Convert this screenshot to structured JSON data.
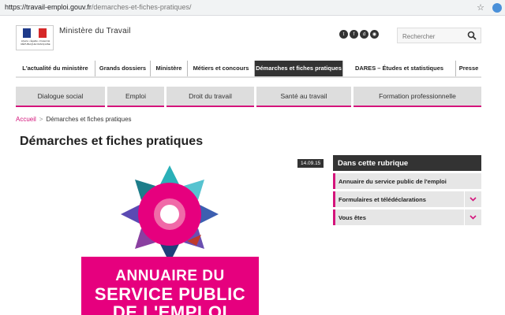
{
  "browser": {
    "url_host": "https://travail-emploi.gouv.fr",
    "url_path": "/demarches-et-fiches-pratiques/"
  },
  "header": {
    "logo_text": "Liberté • Égalité • Fraternité RÉPUBLIQUE FRANÇAISE",
    "site_title": "Ministère du Travail",
    "social": [
      "twitter-icon",
      "facebook-icon",
      "dailymotion-icon",
      "rss-icon"
    ],
    "search_placeholder": "Rechercher"
  },
  "nav": {
    "items": [
      {
        "label": "L'actualité du ministère"
      },
      {
        "label": "Grands dossiers"
      },
      {
        "label": "Ministère"
      },
      {
        "label": "Métiers et concours"
      },
      {
        "label": "Démarches et fiches pratiques"
      },
      {
        "label": "DARES – Études et statistiques"
      },
      {
        "label": "Presse"
      }
    ],
    "active_index": 4
  },
  "subnav": {
    "items": [
      "Dialogue social",
      "Emploi",
      "Droit du travail",
      "Santé au travail",
      "Formation professionnelle"
    ]
  },
  "breadcrumb": {
    "home": "Accueil",
    "separator": ">",
    "current": "Démarches et fiches pratiques"
  },
  "page": {
    "title": "Démarches et fiches pratiques",
    "date": "14.09.15"
  },
  "poster": {
    "line1": "ANNUAIRE DU",
    "line2": "SERVICE PUBLIC",
    "line3": "DE L'EMPLOI"
  },
  "sidebar": {
    "heading": "Dans cette rubrique",
    "items": [
      {
        "label": "Annuaire du service public de l'emploi"
      },
      {
        "label": "Formulaires et télédéclarations"
      },
      {
        "label": "Vous êtes"
      }
    ]
  },
  "colors": {
    "accent": "#d4147b",
    "dark": "#333333"
  }
}
